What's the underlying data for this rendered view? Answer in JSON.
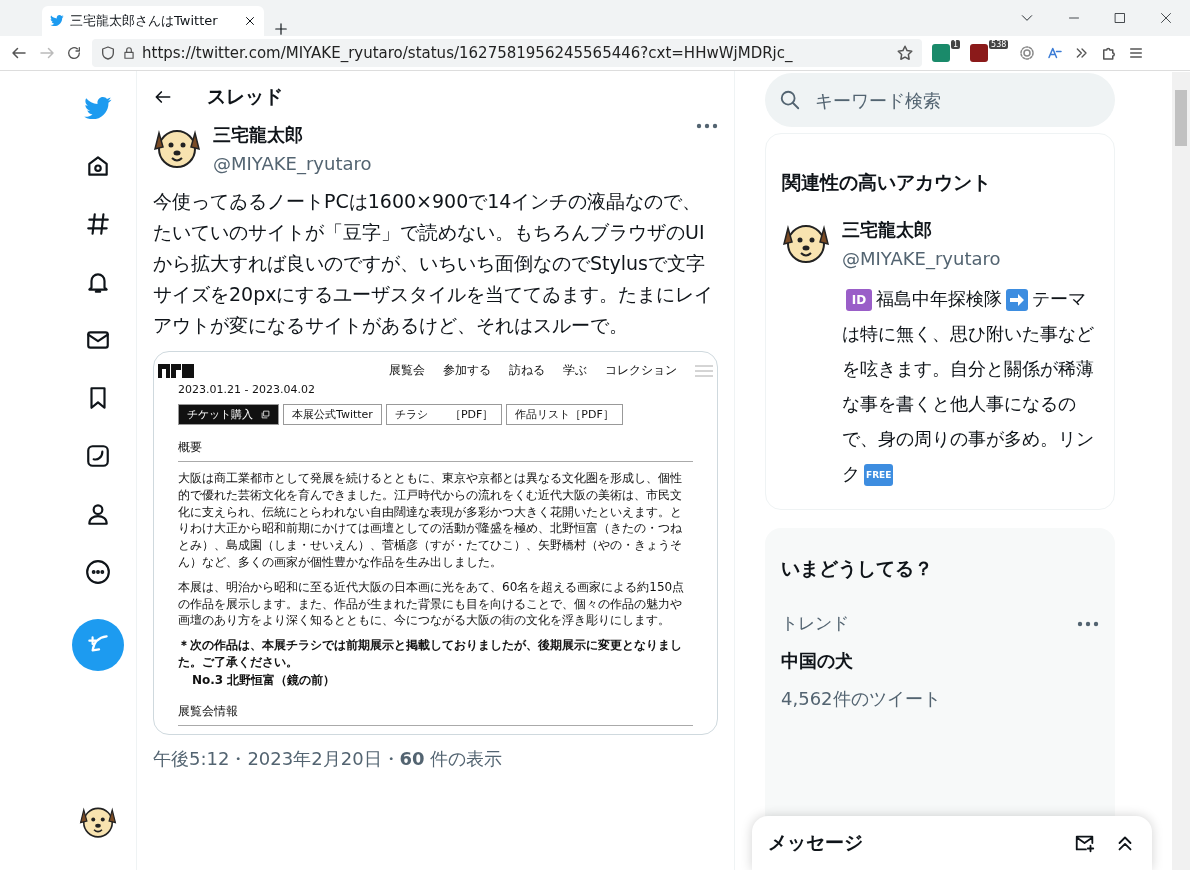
{
  "browser": {
    "tab_title": "三宅龍太郎さんはTwitter",
    "url": "https://twitter.com/MIYAKE_ryutaro/status/1627581956245565446?cxt=HHwWjMDRjc_",
    "extension_badges": [
      "1",
      "538"
    ]
  },
  "header": {
    "title": "スレッド"
  },
  "tweet": {
    "author_name": "三宅龍太郎",
    "handle": "@MIYAKE_ryutaro",
    "text": "今使ってゐるノートPCは1600×900で14インチの液晶なので、たいていのサイトが「豆字」で読めない。もちろんブラウザのUIから拡大すれば良いのですが、いちいち面倒なのでStylusで文字サイズを20pxにするユーザスタイルを当ててゐます。たまにレイアウトが変になるサイトがあるけど、それはスルーで。",
    "meta": "午後5:12・2023年2月20日・**60** 件の表示",
    "embed": {
      "nav": [
        "展覧会",
        "参加する",
        "訪ねる",
        "学ぶ",
        "コレクション"
      ],
      "date": "2023.01.21 - 2023.04.02",
      "buttons": [
        {
          "label": "チケット購入",
          "kind": "primary"
        },
        {
          "label": "本展公式Twitter",
          "kind": "outline"
        },
        {
          "label": "チラシ　　［PDF］",
          "kind": "outline"
        },
        {
          "label": "作品リスト［PDF］",
          "kind": "outline"
        }
      ],
      "section_title": "概要",
      "paragraphs": [
        "大阪は商工業都市として発展を続けるとともに、東京や京都とは異なる文化圏を形成し、個性的で優れた芸術文化を育んできました。江戸時代からの流れをくむ近代大阪の美術は、市民文化に支えられ、伝統にとらわれない自由闊達な表現が多彩かつ大きく花開いたといえます。とりわけ大正から昭和前期にかけては画壇としての活動が隆盛を極め、北野恒富（きたの・つねとみ）、島成園（しま・せいえん）、菅楯彦（すが・たてひこ）、矢野橋村（やの・きょうそん）など、多くの画家が個性豊かな作品を生み出しました。",
        "本展は、明治から昭和に至る近代大阪の日本画に光をあて、60名を超える画家による約150点の作品を展示します。また、作品が生まれた背景にも目を向けることで、個々の作品の魅力や画壇のあり方をより深く知るとともに、今につながる大阪の街の文化を浮き彫りにします。"
      ],
      "note": "＊次の作品は、本展チラシでは前期展示と掲載しておりましたが、後期展示に変更となりました。ご了承ください。",
      "note_item": "No.3 北野恒富（鏡の前）",
      "section_title_2": "展覧会情報"
    }
  },
  "search": {
    "placeholder": "キーワード検索"
  },
  "related": {
    "title": "関連性の高いアカウント",
    "name": "三宅龍太郎",
    "handle": "@MIYAKE_ryutaro",
    "bio": [
      {
        "kind": "badge",
        "text": "ID",
        "color": "#9a5ec8"
      },
      {
        "kind": "text",
        "text": "福島中年探検隊"
      },
      {
        "kind": "arrow",
        "color": "#3d8de0"
      },
      {
        "kind": "text",
        "text": "テーマは特に無く、思ひ附いた事などを呟きます。自分と關係が稀薄な事を書くと他人事になるので、身の周りの事が多め。リンク"
      },
      {
        "kind": "badge",
        "text": "FREE",
        "color": "#3d8de0"
      }
    ]
  },
  "trends": {
    "title": "いまどうしてる？",
    "items": [
      {
        "context": "トレンド",
        "name": "中国の犬",
        "count": "4,562件のツイート"
      }
    ]
  },
  "messages": {
    "title": "メッセージ"
  }
}
